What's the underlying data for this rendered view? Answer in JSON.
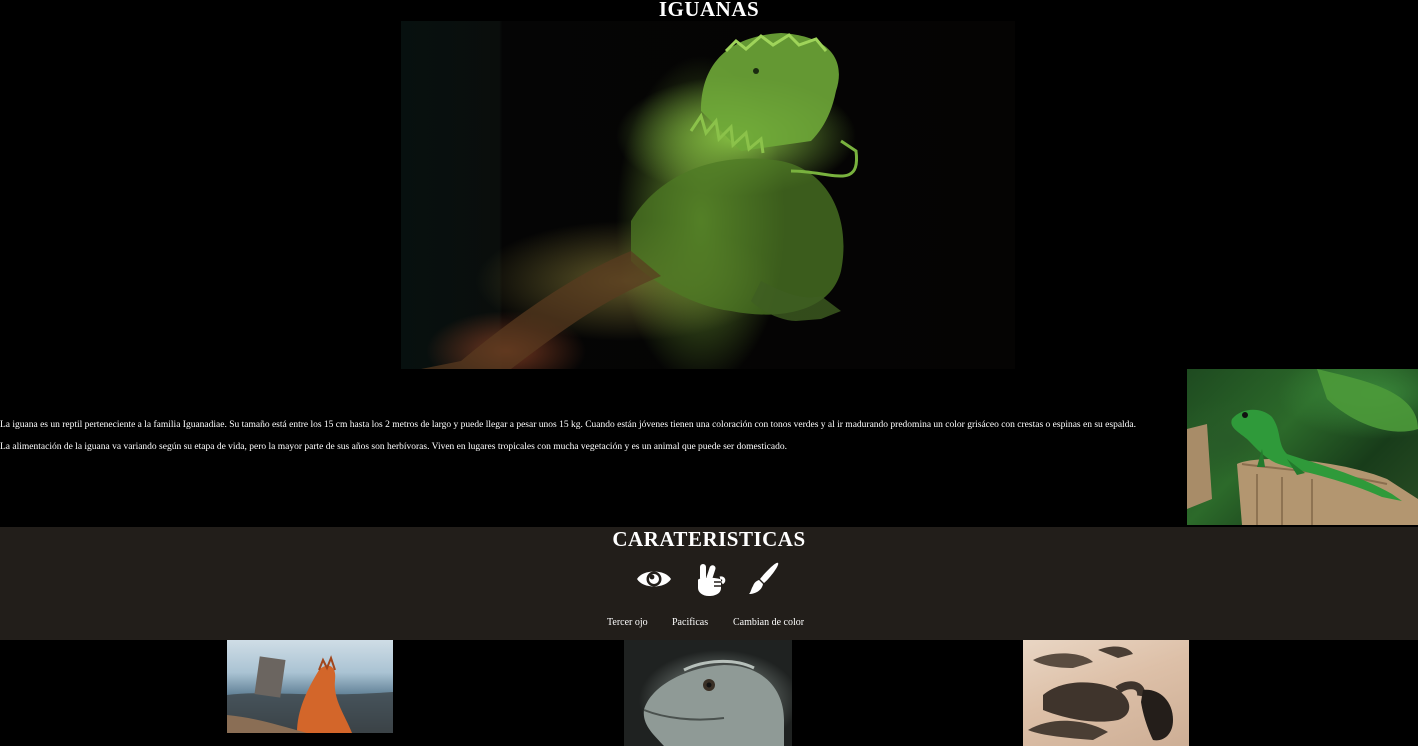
{
  "header": {
    "title": "IGUANAS"
  },
  "intro": {
    "paragraphs": [
      "La iguana es un reptil perteneciente a la familia Iguanadiae. Su tamaño está entre los 15 cm hasta los 2 metros de largo y puede llegar a pesar unos 15 kg. Cuando están jóvenes tienen una coloración con tonos verdes y al ir madurando predomina un color grisáceo con crestas o espinas en su espalda.",
      "La alimentación de la iguana va variando según su etapa de vida, pero la mayor parte de sus años son herbívoras. Viven en lugares tropicales con mucha vegetación y es un animal que puede ser domesticado."
    ]
  },
  "features": {
    "title": "CARATERISTICAS",
    "items": [
      {
        "label": "Tercer ojo",
        "icon": "eye-icon"
      },
      {
        "label": "Pacificas",
        "icon": "peace-hand-icon"
      },
      {
        "label": "Cambian de color",
        "icon": "paint-brush-icon"
      }
    ]
  },
  "colors": {
    "page_background": "#000000",
    "features_background": "#221e1a",
    "text": "#ffffff"
  }
}
